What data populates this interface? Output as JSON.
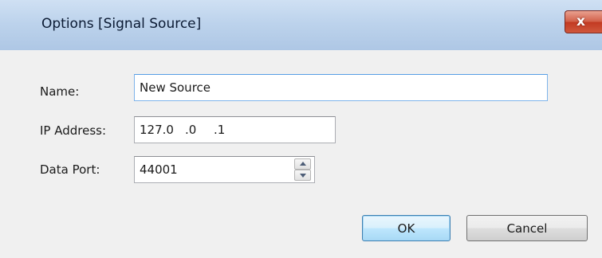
{
  "window": {
    "title": "Options [Signal Source]",
    "close_glyph": "x"
  },
  "form": {
    "name_label": "Name:",
    "name_value": "New Source",
    "ip_label": "IP Address:",
    "ip_segments": [
      "127.0",
      ".0",
      ".1"
    ],
    "port_label": "Data Port:",
    "port_value": "44001"
  },
  "buttons": {
    "ok_label": "OK",
    "cancel_label": "Cancel"
  },
  "icons": {
    "close": "close-icon",
    "spin_up": "chevron-up-icon",
    "spin_down": "chevron-down-icon"
  },
  "colors": {
    "titlebar": "#bdd3ec",
    "close_button": "#c23a22",
    "client_background": "#f0f0f0",
    "focus_border": "#569de5",
    "default_button_border": "#3c7fb1"
  }
}
